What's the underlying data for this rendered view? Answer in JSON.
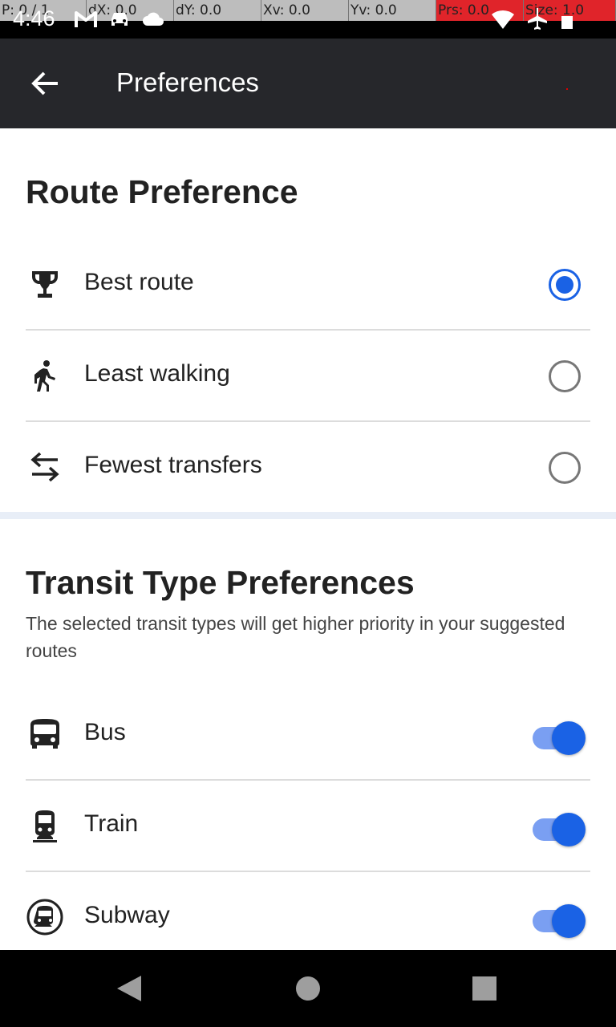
{
  "debug_bar": [
    "P: 0 / 1",
    "dX: 0.0",
    "dY: 0.0",
    "Xv: 0.0",
    "Yv: 0.0",
    "Prs: 0.0",
    "Size: 1.0"
  ],
  "status_bar": {
    "time": "4:46"
  },
  "app_bar": {
    "title": "Preferences"
  },
  "route_section": {
    "title": "Route Preference",
    "options": [
      {
        "label": "Best route",
        "icon": "trophy-icon",
        "selected": true
      },
      {
        "label": "Least walking",
        "icon": "walking-icon",
        "selected": false
      },
      {
        "label": "Fewest transfers",
        "icon": "transfer-arrows-icon",
        "selected": false
      }
    ]
  },
  "transit_section": {
    "title": "Transit Type Preferences",
    "description": "The selected transit types will get higher priority in your suggested routes",
    "types": [
      {
        "label": "Bus",
        "icon": "bus-icon",
        "enabled": true
      },
      {
        "label": "Train",
        "icon": "train-icon",
        "enabled": true
      },
      {
        "label": "Subway",
        "icon": "subway-icon",
        "enabled": true
      }
    ]
  },
  "colors": {
    "accent": "#1a62e5",
    "appbar": "#26272b",
    "switch_track": "#7a9ff2"
  }
}
